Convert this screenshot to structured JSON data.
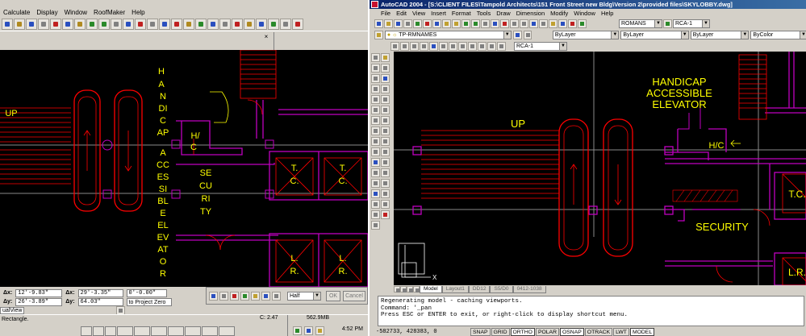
{
  "left_app": {
    "menu": [
      "Calculate",
      "Display",
      "Window",
      "RoofMaker",
      "Help"
    ],
    "subwindow_close": "×",
    "drawing": {
      "handicap_vertical": [
        "H",
        "A",
        "N",
        "DI",
        "C",
        "AP",
        "A",
        "CC",
        "ES",
        "SI",
        "BL",
        "E",
        "EL",
        "EV",
        "AT",
        "O",
        "R"
      ],
      "up": "UP",
      "hc": [
        "H/",
        "C"
      ],
      "security": [
        "SE",
        "CU",
        "RI",
        "TY"
      ],
      "tc": [
        "T.",
        "C."
      ],
      "lr": [
        "L.",
        "R."
      ]
    },
    "status": {
      "dx_label": "Δx:",
      "dx_value": "12'-9.83\"",
      "dy_label": "Δy:",
      "dy_value": "26'-3.89\"",
      "ax_label": "Δx:",
      "ax_value": "29'-3.35\"",
      "ay_label": "Δy:",
      "ay_value": "64.03\"",
      "angle": "0'-0.00\"",
      "to_project_zero": "to Project Zero",
      "view_label": "ualView",
      "rectangle": "Rectangle."
    },
    "zoom_panel": {
      "select": "Half",
      "ok": "OK",
      "cancel": "Cancel"
    }
  },
  "taskbar": {
    "memory": "562.9MB",
    "c_label": "C: 2.47",
    "time": "4:52 PM"
  },
  "right_app": {
    "title": "AutoCAD 2004 - [S:\\CLIENT FILES\\Tampold Architects\\151 Front Street new Bldg\\Version 2\\provided files\\SKYLOBBY.dwg]",
    "menu": [
      "File",
      "Edit",
      "View",
      "Insert",
      "Format",
      "Tools",
      "Draw",
      "Dimension",
      "Modify",
      "Window",
      "Help"
    ],
    "style_dropdowns": {
      "text_style": "ROMANS",
      "dim_style": "RCA-1"
    },
    "layer": "TP-RMNAMES",
    "color": "ByLayer",
    "linetype": "ByLayer",
    "lineweight": "ByLayer",
    "plotstyle": "ByColor",
    "layer_small": "RCA-1",
    "drawing": {
      "handicap": [
        "HANDICAP",
        "ACCESSIBLE",
        "ELEVATOR"
      ],
      "up": "UP",
      "hc": "H/C",
      "security": "SECURITY",
      "tc": "T.C.",
      "lr": "L.R.",
      "ucs_x": "X"
    },
    "tabs": [
      "Model",
      "Layout1",
      "DD12",
      "S5/D0",
      "0412-1038"
    ],
    "command_lines": [
      "Regenerating model - caching viewports.",
      "Command: '_pan",
      "Press ESC or ENTER to exit, or right-click to display shortcut menu."
    ],
    "coords": "-582733, 428383, 0",
    "status_buttons": [
      "SNAP",
      "GRID",
      "ORTHO",
      "POLAR",
      "OSNAP",
      "OTRACK",
      "LWT",
      "MODEL"
    ]
  },
  "colors": {
    "canvas": "#000000",
    "wall_red": "#ff0000",
    "magenta": "#c000c0",
    "text_yellow": "#ffff00",
    "gray_line": "#8a8a8a",
    "title_blue": "#0a246a"
  }
}
